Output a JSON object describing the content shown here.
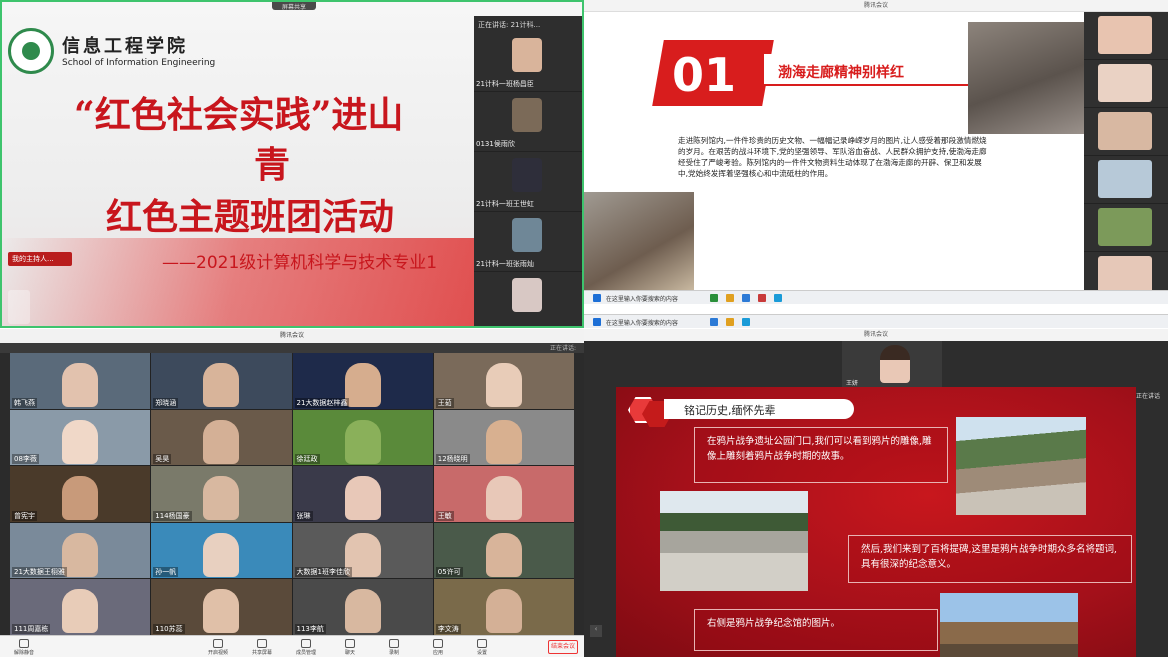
{
  "q1": {
    "top_chip": "屏幕共享",
    "school_cn": "信息工程学院",
    "school_en": "School of Information Engineering",
    "title_line1": "“红色社会实践”进山",
    "title_line2": "青",
    "title_line3": "红色主题班团活动",
    "subtitle": "——2021级计算机科学与技术专业1",
    "presenter_chip": "我的主持人...",
    "video_list_header": "正在讲话: 21计科...",
    "participants": [
      {
        "label": "21计科一班杨昌臣",
        "face": "#d9b49b"
      },
      {
        "label": "0131侯雨欣",
        "face": "#7b6a58"
      },
      {
        "label": "21计科一班王世虹",
        "face": "#2e2e3a"
      },
      {
        "label": "21计科一班张雨灿",
        "face": "#6f8797"
      },
      {
        "label": "",
        "face": "#d8c8c4"
      }
    ]
  },
  "q2": {
    "title_bar": "腾讯会议",
    "number": "01",
    "heading": "渤海走廊精神别样红",
    "paragraph": "走进陈列馆内,一件件珍贵的历史文物、一幅幅记录峥嵘岁月的图片,让人感受着那段激情燃烧的岁月。在艰苦的战斗环境下,党的坚强领导、军队浴血奋战、人民群众拥护支持,使渤海走廊经受住了严峻考验。陈列馆内的一件件文物资料生动体现了在渤海走廊的开辟、保卫和发展中,党始终发挥着坚强核心和中流砥柱的作用。",
    "side_faces": [
      "#e8c4b0",
      "#ead2c4",
      "#d8b8a2",
      "#b7c9d8",
      "#7c9a5a",
      "#e6c8b8"
    ],
    "taskbar1": "在这里输入你要搜索的内容",
    "taskbar2": "在这里输入你要搜索的内容"
  },
  "q3": {
    "title_bar": "腾讯会议",
    "speaking": "正在讲话:",
    "tiles": [
      {
        "name": "韩飞燕",
        "bg": "#5a6a7a",
        "face": "#e2c2ae"
      },
      {
        "name": "郑晓涵",
        "bg": "#3d4a5c",
        "face": "#d8b49a"
      },
      {
        "name": "21大数据赵梓鑫",
        "bg": "#1e2a4a",
        "face": "#d6ad8e"
      },
      {
        "name": "王茹",
        "bg": "#7a6a5a",
        "face": "#e8ccb8"
      },
      {
        "name": "08李薇",
        "bg": "#8a9aa8",
        "face": "#f0d8c8"
      },
      {
        "name": "吴昊",
        "bg": "#6a5a4a",
        "face": "#d4b096"
      },
      {
        "name": "徐廷政",
        "bg": "#5a8a3a",
        "face": "#8ab05a"
      },
      {
        "name": "12杨晓明",
        "bg": "#8a8a8a",
        "face": "#d8b090"
      },
      {
        "name": "曾宪宇",
        "bg": "#4a3a2a",
        "face": "#c89a7a"
      },
      {
        "name": "114杨国豪",
        "bg": "#7a7a6a",
        "face": "#d8b8a0"
      },
      {
        "name": "张琳",
        "bg": "#3a3a4a",
        "face": "#e8c8b8"
      },
      {
        "name": "王敏",
        "bg": "#c86a6a",
        "face": "#e8c8b8"
      },
      {
        "name": "21大数据王栩雅",
        "bg": "#7a8a9a",
        "face": "#d8b8a0"
      },
      {
        "name": "孙一帆",
        "bg": "#3a8aba",
        "face": "#e8d0c0"
      },
      {
        "name": "大数据1班李佳欣",
        "bg": "#5a5a5a",
        "face": "#e2c4b0"
      },
      {
        "name": "05许可",
        "bg": "#4a5a4a",
        "face": "#d8b49a"
      },
      {
        "name": "111周嘉栋",
        "bg": "#6a6a7a",
        "face": "#e8ccb8"
      },
      {
        "name": "110苏蕊",
        "bg": "#5a4a3a",
        "face": "#e0c0a8"
      },
      {
        "name": "113李航",
        "bg": "#4a4a4a",
        "face": "#d8b8a0"
      },
      {
        "name": "李文涛",
        "bg": "#7a6a4a",
        "face": "#d4b096"
      }
    ],
    "tools": [
      "解除静音",
      "开启视频",
      "共享屏幕",
      "成员管理",
      "聊天",
      "录制",
      "应用",
      "设置"
    ],
    "leave": "结束会议"
  },
  "q4": {
    "title_bar": "腾讯会议",
    "cam_name": "王妍",
    "chip": "正在讲话",
    "heading": "铭记历史,缅怀先辈",
    "box1": "在鸦片战争遗址公园门口,我们可以看到鸦片的雕像,雕像上雕刻着鸦片战争时期的故事。",
    "box2": "然后,我们来到了百将提碑,这里是鸦片战争时期众多名将题词,具有很深的纪念意义。",
    "box3": "右侧是鸦片战争纪念馆的图片。"
  }
}
